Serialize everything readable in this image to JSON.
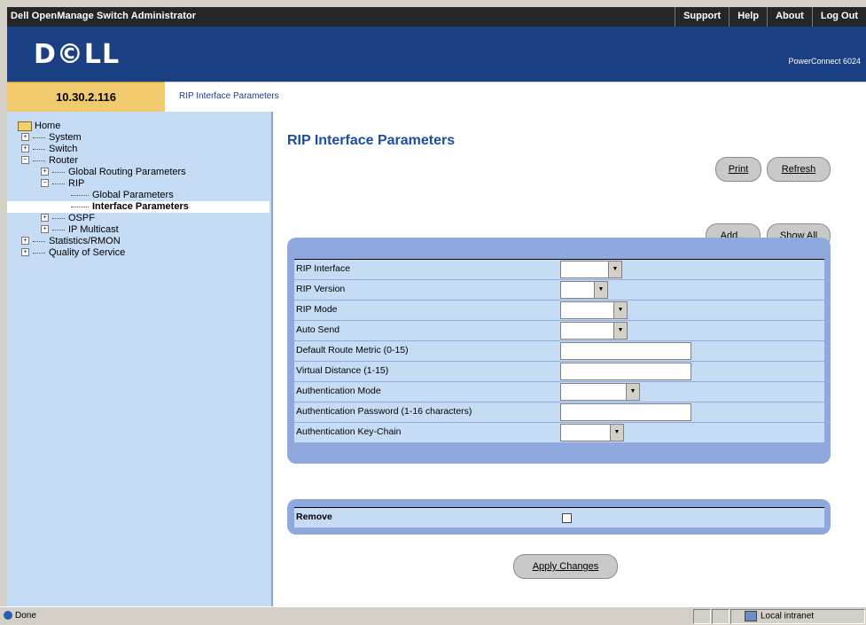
{
  "topbar": {
    "title": "Dell OpenManage Switch Administrator",
    "links": [
      "Support",
      "Help",
      "About",
      "Log Out"
    ]
  },
  "header": {
    "logo": "D©LL",
    "model": "PowerConnect 6024"
  },
  "ip_address": "10.30.2.116",
  "breadcrumb": "RIP Interface Parameters",
  "sidebar": {
    "home": "Home",
    "system": "System",
    "switch": "Switch",
    "router": "Router",
    "global_routing": "Global Routing Parameters",
    "rip": "RIP",
    "global_parameters": "Global Parameters",
    "interface_parameters": "Interface Parameters",
    "ospf": "OSPF",
    "ip_multicast": "IP Multicast",
    "statistics": "Statistics/RMON",
    "qos": "Quality of Service"
  },
  "page_title": "RIP Interface Parameters",
  "buttons": {
    "print": "Print",
    "refresh": "Refresh",
    "add": "Add...",
    "show_all": "Show All",
    "apply": "Apply Changes"
  },
  "form": {
    "rip_interface": "RIP Interface",
    "rip_version": "RIP Version",
    "rip_mode": "RIP Mode",
    "auto_send": "Auto Send",
    "default_route_metric": "Default Route Metric (0-15)",
    "virtual_distance": "Virtual Distance (1-15)",
    "auth_mode": "Authentication Mode",
    "auth_password": "Authentication Password (1-16 characters)",
    "auth_key_chain": "Authentication Key-Chain",
    "remove": "Remove"
  },
  "status": {
    "left": "Done",
    "zone": "Local intranet"
  }
}
